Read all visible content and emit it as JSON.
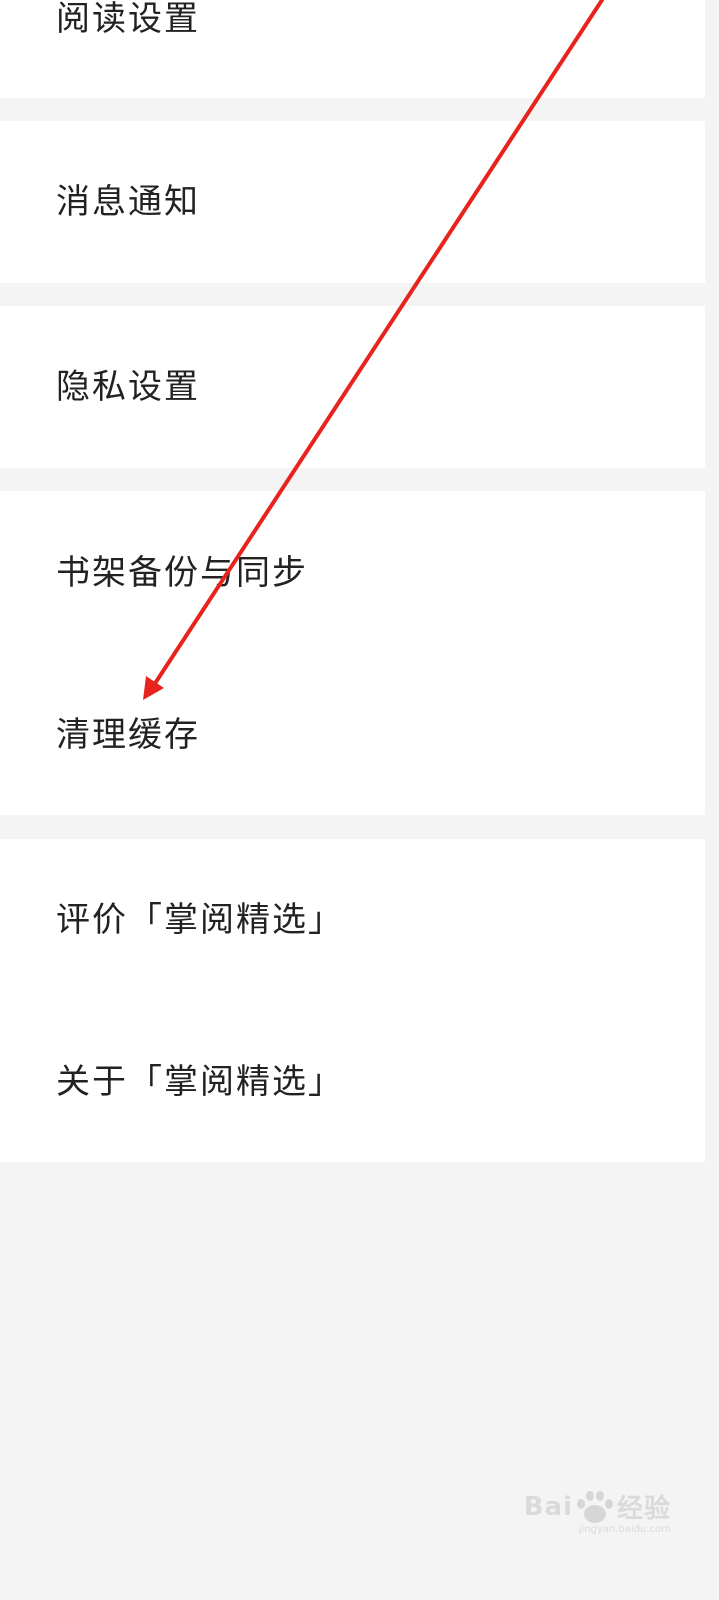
{
  "settings_list": [
    {
      "key": "reading",
      "label": "阅读设置"
    },
    {
      "key": "notify",
      "label": "消息通知"
    },
    {
      "key": "privacy",
      "label": "隐私设置"
    },
    {
      "key": "backup",
      "label": "书架备份与同步"
    },
    {
      "key": "cache",
      "label": "清理缓存"
    },
    {
      "key": "rate",
      "label": "评价「掌阅精选」"
    },
    {
      "key": "about",
      "label": "关于「掌阅精选」"
    }
  ],
  "annotation": {
    "arrow_color": "#e8231e",
    "points_to": "清理缓存"
  },
  "watermark": {
    "text_left": "Bai",
    "text_right": "经验",
    "subtext": "jingyan.baidu.com"
  },
  "colors": {
    "background": "#f4f4f4",
    "card": "#ffffff",
    "text": "#222222"
  }
}
